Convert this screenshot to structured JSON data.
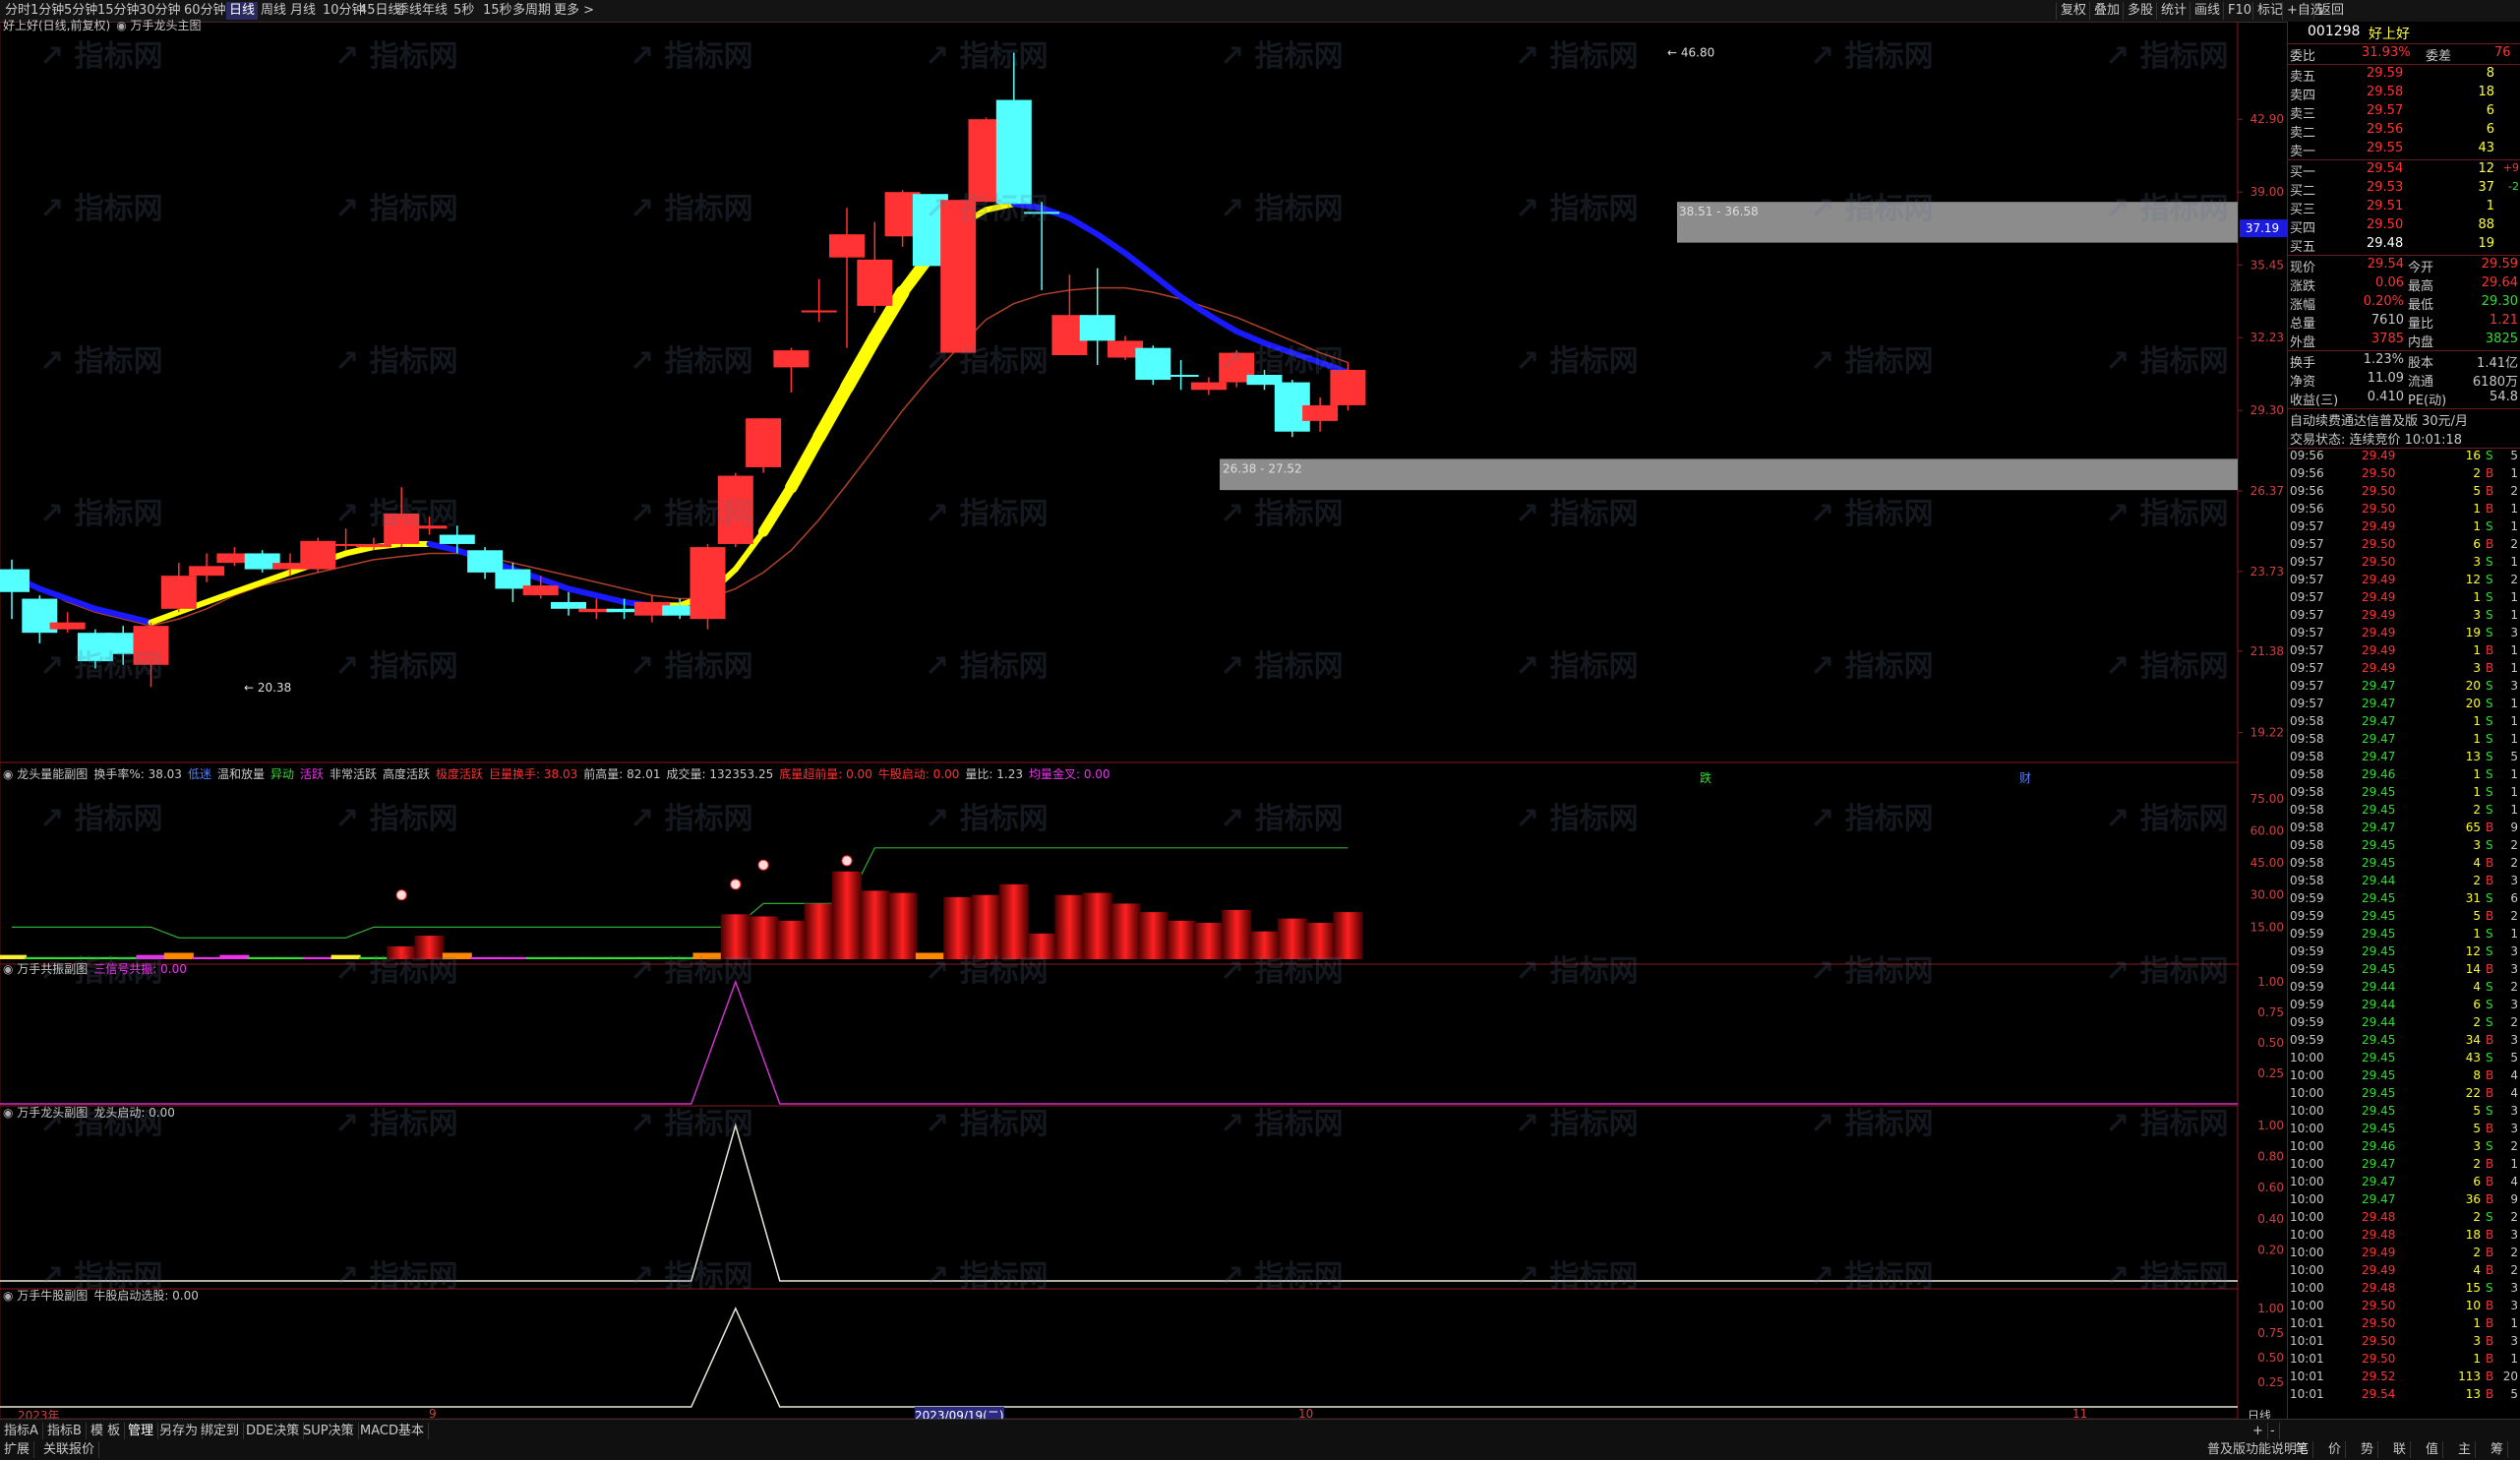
{
  "toolbar": {
    "periods": [
      "分时",
      "1分钟",
      "5分钟",
      "15分钟",
      "30分钟",
      "60分钟",
      "日线",
      "周线",
      "月线",
      "10分钟",
      "45日线",
      "季线",
      "年线",
      "5秒",
      "15秒",
      "多周期",
      "更多 >"
    ],
    "active_period": "日线",
    "right_buttons": [
      "复权",
      "叠加",
      "多股",
      "统计",
      "画线",
      "F10",
      "标记",
      "+自选",
      "返回"
    ]
  },
  "main_chart": {
    "stock_title": "好上好(日线,前复权)",
    "indicator_name": "万手龙头主图",
    "y_ticks": [
      "42.90",
      "39.00",
      "35.45",
      "32.23",
      "29.30",
      "26.37",
      "23.73",
      "21.38",
      "19.22"
    ],
    "annotations": {
      "high": "46.80",
      "low": "20.38",
      "zone_top": "38.51 - 36.58",
      "zone_bottom": "26.38 - 27.52",
      "current_price_tag": "37.19"
    },
    "candles": [
      {
        "o": 23.8,
        "c": 23.1,
        "h": 24.1,
        "l": 22.3,
        "color": "cyan"
      },
      {
        "o": 22.9,
        "c": 21.9,
        "h": 23.0,
        "l": 21.6,
        "color": "cyan"
      },
      {
        "o": 22.0,
        "c": 22.2,
        "h": 22.5,
        "l": 21.9,
        "color": "red"
      },
      {
        "o": 21.9,
        "c": 21.1,
        "h": 22.0,
        "l": 20.9,
        "color": "cyan"
      },
      {
        "o": 21.3,
        "c": 21.9,
        "h": 22.1,
        "l": 21.0,
        "color": "cyan"
      },
      {
        "o": 21.0,
        "c": 22.1,
        "h": 22.2,
        "l": 20.4,
        "color": "red"
      },
      {
        "o": 22.6,
        "c": 23.6,
        "h": 24.0,
        "l": 22.5,
        "color": "red"
      },
      {
        "o": 23.6,
        "c": 23.9,
        "h": 24.3,
        "l": 23.4,
        "color": "red"
      },
      {
        "o": 24.0,
        "c": 24.3,
        "h": 24.5,
        "l": 23.9,
        "color": "red"
      },
      {
        "o": 24.3,
        "c": 23.8,
        "h": 24.4,
        "l": 23.7,
        "color": "cyan"
      },
      {
        "o": 23.8,
        "c": 24.0,
        "h": 24.3,
        "l": 23.6,
        "color": "red"
      },
      {
        "o": 23.8,
        "c": 24.7,
        "h": 24.8,
        "l": 23.7,
        "color": "red"
      },
      {
        "o": 24.6,
        "c": 24.6,
        "h": 25.1,
        "l": 24.4,
        "color": "red"
      },
      {
        "o": 24.5,
        "c": 24.6,
        "h": 24.8,
        "l": 24.4,
        "color": "red"
      },
      {
        "o": 24.6,
        "c": 25.6,
        "h": 26.5,
        "l": 24.5,
        "color": "red"
      },
      {
        "o": 25.1,
        "c": 25.2,
        "h": 25.5,
        "l": 24.9,
        "color": "red"
      },
      {
        "o": 24.9,
        "c": 24.6,
        "h": 25.2,
        "l": 24.3,
        "color": "cyan"
      },
      {
        "o": 24.4,
        "c": 23.7,
        "h": 24.5,
        "l": 23.5,
        "color": "cyan"
      },
      {
        "o": 23.8,
        "c": 23.2,
        "h": 24.0,
        "l": 22.8,
        "color": "cyan"
      },
      {
        "o": 23.0,
        "c": 23.3,
        "h": 23.6,
        "l": 22.9,
        "color": "red"
      },
      {
        "o": 22.8,
        "c": 22.6,
        "h": 23.1,
        "l": 22.4,
        "color": "cyan"
      },
      {
        "o": 22.5,
        "c": 22.6,
        "h": 22.9,
        "l": 22.3,
        "color": "red"
      },
      {
        "o": 22.6,
        "c": 22.5,
        "h": 22.9,
        "l": 22.3,
        "color": "cyan"
      },
      {
        "o": 22.4,
        "c": 22.8,
        "h": 23.0,
        "l": 22.2,
        "color": "red"
      },
      {
        "o": 22.7,
        "c": 22.4,
        "h": 22.9,
        "l": 22.3,
        "color": "cyan"
      },
      {
        "o": 22.3,
        "c": 24.5,
        "h": 24.6,
        "l": 22.0,
        "color": "red"
      },
      {
        "o": 24.6,
        "c": 26.9,
        "h": 27.0,
        "l": 24.5,
        "color": "red"
      },
      {
        "o": 27.2,
        "c": 29.0,
        "h": 29.0,
        "l": 27.0,
        "color": "red"
      },
      {
        "o": 31.0,
        "c": 31.7,
        "h": 31.8,
        "l": 30.0,
        "color": "red"
      },
      {
        "o": 33.4,
        "c": 33.4,
        "h": 34.8,
        "l": 32.9,
        "color": "red"
      },
      {
        "o": 35.8,
        "c": 36.9,
        "h": 38.2,
        "l": 31.8,
        "color": "red"
      },
      {
        "o": 33.6,
        "c": 35.7,
        "h": 37.5,
        "l": 33.3,
        "color": "red"
      },
      {
        "o": 36.8,
        "c": 39.0,
        "h": 39.1,
        "l": 36.3,
        "color": "red"
      },
      {
        "o": 38.9,
        "c": 35.4,
        "h": 38.9,
        "l": 35.4,
        "color": "cyan"
      },
      {
        "o": 31.6,
        "c": 38.6,
        "h": 38.6,
        "l": 31.6,
        "color": "red"
      },
      {
        "o": 38.5,
        "c": 42.9,
        "h": 43.0,
        "l": 38.5,
        "color": "red"
      },
      {
        "o": 44.0,
        "c": 38.4,
        "h": 46.8,
        "l": 38.4,
        "color": "cyan"
      },
      {
        "o": 38.0,
        "c": 38.0,
        "h": 38.5,
        "l": 34.3,
        "color": "cyan"
      },
      {
        "o": 33.2,
        "c": 31.5,
        "h": 35.0,
        "l": 31.5,
        "color": "red"
      },
      {
        "o": 33.2,
        "c": 32.1,
        "h": 35.3,
        "l": 31.1,
        "color": "cyan"
      },
      {
        "o": 31.4,
        "c": 32.1,
        "h": 32.3,
        "l": 31.3,
        "color": "red"
      },
      {
        "o": 31.8,
        "c": 30.5,
        "h": 31.9,
        "l": 30.3,
        "color": "cyan"
      },
      {
        "o": 30.7,
        "c": 30.7,
        "h": 31.3,
        "l": 30.1,
        "color": "cyan"
      },
      {
        "o": 30.1,
        "c": 30.4,
        "h": 30.6,
        "l": 29.9,
        "color": "red"
      },
      {
        "o": 30.4,
        "c": 31.6,
        "h": 31.7,
        "l": 30.2,
        "color": "red"
      },
      {
        "o": 30.7,
        "c": 30.3,
        "h": 30.9,
        "l": 30.1,
        "color": "cyan"
      },
      {
        "o": 30.4,
        "c": 28.5,
        "h": 30.5,
        "l": 28.3,
        "color": "cyan"
      },
      {
        "o": 28.9,
        "c": 29.5,
        "h": 29.8,
        "l": 28.5,
        "color": "red"
      },
      {
        "o": 29.5,
        "c": 30.9,
        "h": 31.2,
        "l": 29.3,
        "color": "red"
      }
    ]
  },
  "vol_panel": {
    "title": "龙头量能副图",
    "rate_label": "换手率%: 38.03",
    "l1": "低迷",
    "l2": "温和放量",
    "l3": "异动",
    "l4": "活跃",
    "l5": "非常活跃",
    "l6": "高度活跃",
    "l7": "极度活跃",
    "l8": "巨量换手: 38.03",
    "strong": "前高量: 82.01",
    "vol": "成交量: 132353.25",
    "e1": "底量超前量: 0.00",
    "e2": "牛股启动: 0.00",
    "ratio": "量比: 1.23",
    "e3": "均量金叉: 0.00",
    "y_ticks": [
      "75.00",
      "60.00",
      "45.00",
      "30.00",
      "15.00"
    ],
    "markers": [
      "跌",
      "财"
    ],
    "bars": [
      2,
      1,
      1,
      1,
      1,
      2,
      3,
      1,
      2,
      1,
      1,
      1,
      2,
      1,
      6,
      11,
      3,
      1,
      1,
      1,
      1,
      1,
      1,
      1,
      1,
      3,
      21,
      20,
      18,
      26,
      41,
      32,
      31,
      3,
      29,
      30,
      35,
      12,
      30,
      31,
      26,
      22,
      18,
      17,
      23,
      13,
      19,
      17,
      22
    ]
  },
  "panel2": {
    "title": "万手共振副图",
    "sub": "三信号共振: 0.00",
    "y_ticks": [
      "1.00",
      "0.75",
      "0.50",
      "0.25"
    ]
  },
  "panel3": {
    "title": "万手龙头副图",
    "sub": "龙头启动: 0.00",
    "y_ticks": [
      "1.00",
      "0.80",
      "0.60",
      "0.40",
      "0.20"
    ]
  },
  "panel4": {
    "title": "万手牛股副图",
    "sub": "牛股启动选股: 0.00",
    "y_ticks": [
      "1.00",
      "0.75",
      "0.50",
      "0.25"
    ]
  },
  "xaxis": {
    "labels": [
      "2023年",
      "9",
      "2023/09/19(二)",
      "10",
      "11"
    ],
    "right": "日线"
  },
  "right_panel": {
    "code": "001298",
    "name": "好上好",
    "webi": {
      "label": "委比",
      "value": "31.93%",
      "label2": "委差",
      "value2": "76"
    },
    "asks": [
      [
        "卖五",
        "29.59",
        "8"
      ],
      [
        "卖四",
        "29.58",
        "18"
      ],
      [
        "卖三",
        "29.57",
        "6"
      ],
      [
        "卖二",
        "29.56",
        "6"
      ],
      [
        "卖一",
        "29.55",
        "43"
      ]
    ],
    "bids": [
      [
        "买一",
        "29.54",
        "12",
        "+9"
      ],
      [
        "买二",
        "29.53",
        "37",
        "-2"
      ],
      [
        "买三",
        "29.51",
        "1",
        ""
      ],
      [
        "买四",
        "29.50",
        "88",
        ""
      ],
      [
        "买五",
        "29.48",
        "19",
        ""
      ]
    ],
    "stats": [
      [
        "现价",
        "29.54",
        "今开",
        "29.59"
      ],
      [
        "涨跌",
        "0.06",
        "最高",
        "29.64"
      ],
      [
        "涨幅",
        "0.20%",
        "最低",
        "29.30"
      ],
      [
        "总量",
        "7610",
        "量比",
        "1.21"
      ],
      [
        "外盘",
        "3785",
        "内盘",
        "3825"
      ],
      [
        "换手",
        "1.23%",
        "股本",
        "1.41亿"
      ],
      [
        "净资",
        "11.09",
        "流通",
        "6180万"
      ],
      [
        "收益(三)",
        "0.410",
        "PE(动)",
        "54.8"
      ]
    ],
    "notice1": "自动续费通达信普及版 30元/月",
    "notice2": "交易状态: 连续竞价 10:01:18",
    "ticks": [
      [
        "09:56",
        "29.49",
        "16",
        "S",
        "5"
      ],
      [
        "09:56",
        "29.50",
        "2",
        "B",
        "1"
      ],
      [
        "09:56",
        "29.50",
        "5",
        "B",
        "2"
      ],
      [
        "09:56",
        "29.50",
        "1",
        "B",
        "1"
      ],
      [
        "09:57",
        "29.49",
        "1",
        "S",
        "1"
      ],
      [
        "09:57",
        "29.50",
        "6",
        "B",
        "2"
      ],
      [
        "09:57",
        "29.50",
        "3",
        "S",
        "1"
      ],
      [
        "09:57",
        "29.49",
        "12",
        "S",
        "2"
      ],
      [
        "09:57",
        "29.49",
        "1",
        "S",
        "1"
      ],
      [
        "09:57",
        "29.49",
        "3",
        "S",
        "1"
      ],
      [
        "09:57",
        "29.49",
        "19",
        "S",
        "3"
      ],
      [
        "09:57",
        "29.49",
        "1",
        "B",
        "1"
      ],
      [
        "09:57",
        "29.49",
        "3",
        "B",
        "1"
      ],
      [
        "09:57",
        "29.47",
        "20",
        "S",
        "3"
      ],
      [
        "09:57",
        "29.47",
        "20",
        "S",
        "1"
      ],
      [
        "09:58",
        "29.47",
        "1",
        "S",
        "1"
      ],
      [
        "09:58",
        "29.47",
        "1",
        "S",
        "1"
      ],
      [
        "09:58",
        "29.47",
        "13",
        "S",
        "5"
      ],
      [
        "09:58",
        "29.46",
        "1",
        "S",
        "1"
      ],
      [
        "09:58",
        "29.45",
        "1",
        "S",
        "1"
      ],
      [
        "09:58",
        "29.45",
        "2",
        "S",
        "1"
      ],
      [
        "09:58",
        "29.47",
        "65",
        "B",
        "9"
      ],
      [
        "09:58",
        "29.45",
        "3",
        "S",
        "2"
      ],
      [
        "09:58",
        "29.45",
        "4",
        "B",
        "2"
      ],
      [
        "09:58",
        "29.44",
        "2",
        "B",
        "3"
      ],
      [
        "09:59",
        "29.45",
        "31",
        "S",
        "6"
      ],
      [
        "09:59",
        "29.45",
        "5",
        "B",
        "2"
      ],
      [
        "09:59",
        "29.45",
        "1",
        "S",
        "1"
      ],
      [
        "09:59",
        "29.45",
        "12",
        "S",
        "3"
      ],
      [
        "09:59",
        "29.45",
        "14",
        "B",
        "3"
      ],
      [
        "09:59",
        "29.44",
        "4",
        "S",
        "2"
      ],
      [
        "09:59",
        "29.44",
        "6",
        "S",
        "3"
      ],
      [
        "09:59",
        "29.44",
        "2",
        "S",
        "2"
      ],
      [
        "09:59",
        "29.45",
        "34",
        "B",
        "3"
      ],
      [
        "10:00",
        "29.45",
        "43",
        "S",
        "5"
      ],
      [
        "10:00",
        "29.45",
        "8",
        "B",
        "4"
      ],
      [
        "10:00",
        "29.45",
        "22",
        "B",
        "4"
      ],
      [
        "10:00",
        "29.45",
        "5",
        "S",
        "3"
      ],
      [
        "10:00",
        "29.45",
        "5",
        "B",
        "3"
      ],
      [
        "10:00",
        "29.46",
        "3",
        "S",
        "2"
      ],
      [
        "10:00",
        "29.47",
        "2",
        "B",
        "1"
      ],
      [
        "10:00",
        "29.47",
        "6",
        "B",
        "4"
      ],
      [
        "10:00",
        "29.47",
        "36",
        "B",
        "9"
      ],
      [
        "10:00",
        "29.48",
        "2",
        "S",
        "2"
      ],
      [
        "10:00",
        "29.48",
        "18",
        "B",
        "3"
      ],
      [
        "10:00",
        "29.49",
        "2",
        "B",
        "2"
      ],
      [
        "10:00",
        "29.49",
        "4",
        "B",
        "2"
      ],
      [
        "10:00",
        "29.48",
        "15",
        "S",
        "3"
      ],
      [
        "10:00",
        "29.50",
        "10",
        "B",
        "3"
      ],
      [
        "10:01",
        "29.50",
        "1",
        "B",
        "1"
      ],
      [
        "10:01",
        "29.50",
        "3",
        "B",
        "3"
      ],
      [
        "10:01",
        "29.50",
        "1",
        "B",
        "1"
      ],
      [
        "10:01",
        "29.52",
        "113",
        "B",
        "20"
      ],
      [
        "10:01",
        "29.54",
        "13",
        "B",
        "5"
      ]
    ]
  },
  "bottom": {
    "tabs": [
      "指标A",
      "指标B",
      "模 板",
      "管理",
      "另存为",
      "绑定到",
      "DDE决策",
      "SUP决策",
      "MACD基本"
    ],
    "row2_left": "扩展",
    "row2_left2": "关联报价",
    "row2_right": "普及版功能说明",
    "right_tabs": [
      "笔",
      "价",
      "势",
      "联",
      "值",
      "主",
      "筹"
    ]
  },
  "colors": {
    "red": "#ff3333",
    "cyan": "#54ffff",
    "yellow": "#ffff00",
    "blue": "#1a1aff",
    "green": "#33dd33"
  }
}
